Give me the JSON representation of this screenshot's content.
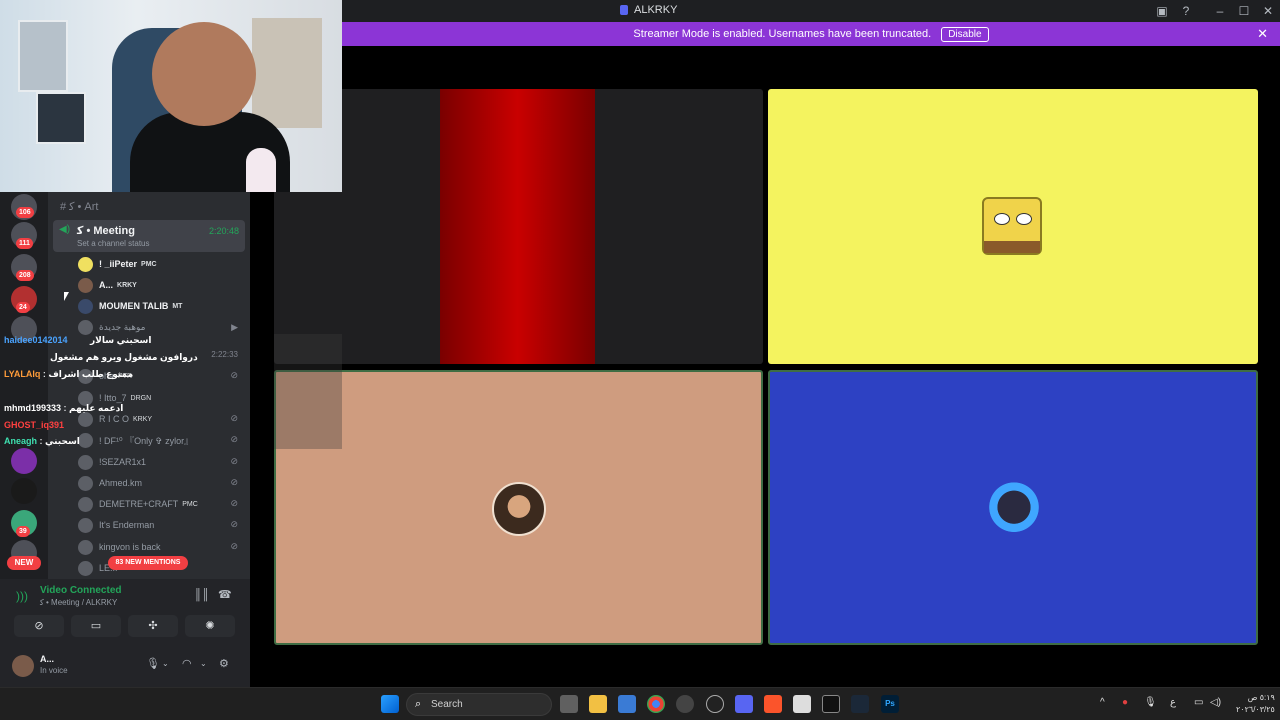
{
  "window": {
    "title": "ALKRKY"
  },
  "banner": {
    "text": "Streamer Mode is enabled. Usernames have been truncated.",
    "disable_label": "Disable",
    "color": "#8c35d6"
  },
  "servers": {
    "badges": [
      "106",
      "111",
      "208",
      "24",
      "39"
    ],
    "new_label": "NEW"
  },
  "channels": {
    "art": "ﮐ • Art",
    "meeting": {
      "name": "ﮐ • Meeting",
      "status": "Set a channel status",
      "timer": "2:20:48"
    },
    "voice_users": [
      {
        "name": "! _iiPeter",
        "tag": "PMC"
      },
      {
        "name": "A...",
        "tag": "KRKY"
      },
      {
        "name": "MOUMEN TALIB",
        "tag": "MT"
      },
      {
        "name": "موهبة جديدة",
        "tag": ""
      },
      {
        "name": "",
        "tag": ""
      },
      {
        "name": "oha",
        "tag": "PTR"
      },
      {
        "name": "! Itto_7",
        "tag": "DRGN"
      },
      {
        "name": "R I C O",
        "tag": "KRKY"
      },
      {
        "name": "! DF¹⁰ 『Only ✞ zylor』",
        "tag": ""
      },
      {
        "name": "!SEZAR1x1",
        "tag": ""
      },
      {
        "name": "Ahmed.km",
        "tag": ""
      },
      {
        "name": "DEMETRE+CRAFT",
        "tag": "PMC"
      },
      {
        "name": "It's Enderman",
        "tag": ""
      },
      {
        "name": "kingvon is back",
        "tag": ""
      },
      {
        "name": "LE...",
        "tag": ""
      }
    ],
    "second_timer": "2:22:33",
    "mentions_label": "83 NEW MENTIONS"
  },
  "chat": [
    {
      "user": "",
      "message": "اسحبني سالار",
      "color": "#ffffff"
    },
    {
      "user": "haidee0142014",
      "message": "",
      "color": "#4aa3ff"
    },
    {
      "user": "",
      "message": "دروافون مشغول ويرو هم مشغول",
      "color": "#ffffff"
    },
    {
      "user": "LYALAlq",
      "message": "ممنوع طلب اشراف",
      "color": "#ff9c3a"
    },
    {
      "user": "",
      "message": "",
      "color": "#ff4040"
    },
    {
      "user": "mhmd199333",
      "message": "ادعمه عليهم",
      "color": "#ffffff"
    },
    {
      "user": "GHOST_iq391",
      "message": "",
      "color": "#ff4040"
    },
    {
      "user": "Aneagh",
      "message": "اسحبني",
      "color": "#3fe0b0"
    }
  ],
  "voice_panel": {
    "title": "Video Connected",
    "subtitle": "ﮐ • Meeting / ALKRKY",
    "user_name": "A...",
    "user_status": "In voice"
  },
  "taskbar": {
    "search_placeholder": "Search",
    "clock_time": "٥:١٩ ص",
    "clock_date": "٢٠٢٦/٠٣/٢٥"
  }
}
